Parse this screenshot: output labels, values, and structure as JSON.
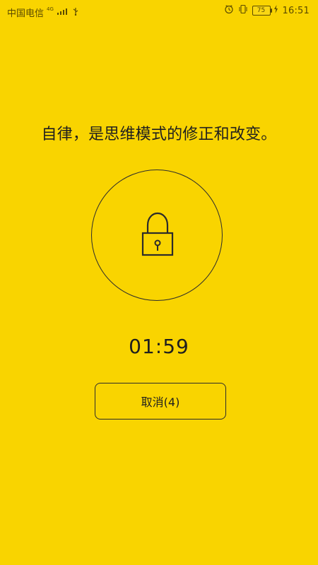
{
  "status_bar": {
    "carrier": "中国电信",
    "network_type": "4G",
    "battery": "75",
    "time": "16:51",
    "icons": {
      "signal": "signal-strength-icon",
      "usb": "usb-icon",
      "alarm": "alarm-clock-icon",
      "vibrate": "vibrate-icon",
      "charging": "charging-bolt-icon"
    }
  },
  "screen": {
    "motto": "自律，是思维模式的修正和改变。",
    "lock_icon": "lock-icon",
    "timer": "01:59",
    "cancel_label": "取消(4)",
    "background_color": "#f9d400"
  }
}
